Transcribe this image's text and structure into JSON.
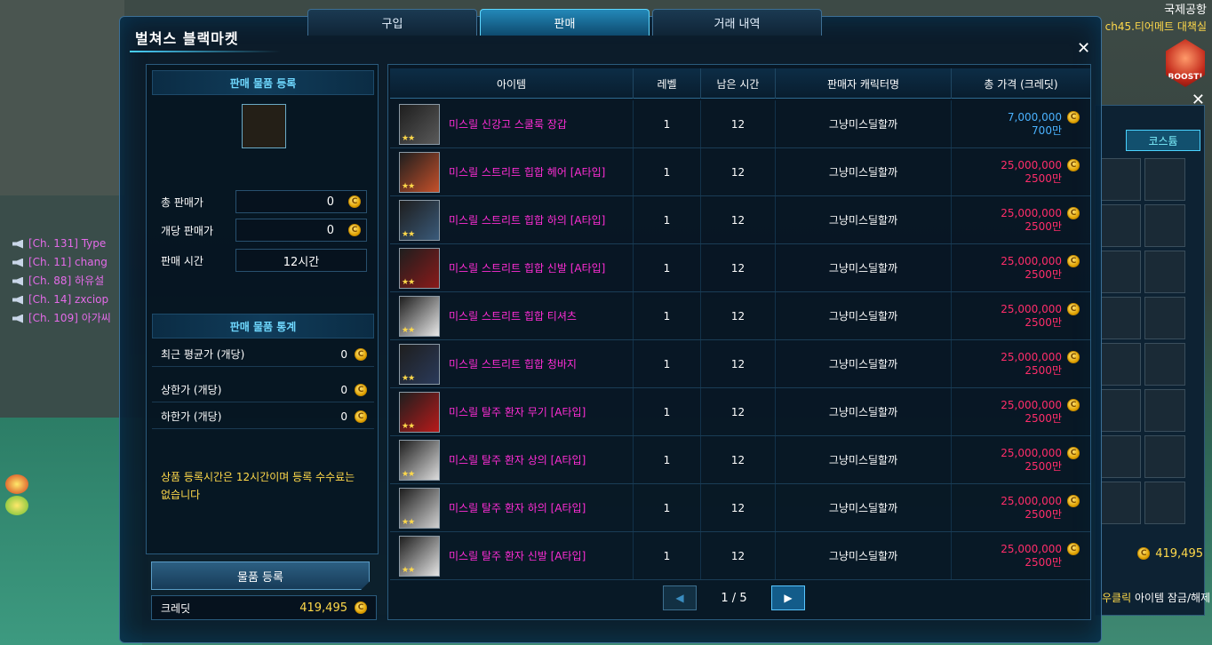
{
  "location": {
    "title": "국제공항",
    "channel": "ch45.티어메트 대책실"
  },
  "boost_label": "BOOST!",
  "chat": [
    {
      "text": "[Ch. 131] Type"
    },
    {
      "text": "[Ch. 11] chang"
    },
    {
      "text": "[Ch. 88] 하유설"
    },
    {
      "text": "[Ch. 14] zxciop"
    },
    {
      "text": "[Ch. 109] 아가씨"
    }
  ],
  "window": {
    "title": "벌쳐스 블랙마켓",
    "tabs": [
      {
        "label": "구입"
      },
      {
        "label": "판매"
      },
      {
        "label": "거래 내역"
      }
    ],
    "active_tab": "판매"
  },
  "register": {
    "header": "판매 물품 등록",
    "total_price_label": "총 판매가",
    "total_price_value": "0",
    "unit_price_label": "개당 판매가",
    "unit_price_value": "0",
    "time_label": "판매 시간",
    "time_value": "12시간"
  },
  "stats": {
    "header": "판매 물품 통계",
    "recent_avg_label": "최근 평균가 (개당)",
    "recent_avg_value": "0",
    "upper_label": "상한가 (개당)",
    "upper_value": "0",
    "lower_label": "하한가 (개당)",
    "lower_value": "0"
  },
  "notice": "상품 등록시간은 12시간이며 등록 수수료는 없습니다",
  "register_button": "물품 등록",
  "credit": {
    "label": "크레딧",
    "amount": "419,495"
  },
  "table": {
    "headers": [
      "아이템",
      "레벨",
      "남은 시간",
      "판매자 캐릭터명",
      "총 가격 (크레딧)"
    ],
    "rows": [
      {
        "name": "미스릴 신강고 스쿨룩 장갑",
        "level": "1",
        "time": "12",
        "seller": "그냥미스딜할까",
        "price": "7,000,000",
        "price_short": "700만",
        "tone": "blue",
        "thumb": "#5a5a5a"
      },
      {
        "name": "미스릴 스트리트 힙합 헤어 [A타입]",
        "level": "1",
        "time": "12",
        "seller": "그냥미스딜할까",
        "price": "25,000,000",
        "price_short": "2500만",
        "tone": "red",
        "thumb": "#c5502a"
      },
      {
        "name": "미스릴 스트리트 힙합 하의 [A타입]",
        "level": "1",
        "time": "12",
        "seller": "그냥미스딜할까",
        "price": "25,000,000",
        "price_short": "2500만",
        "tone": "red",
        "thumb": "#3a5a7a"
      },
      {
        "name": "미스릴 스트리트 힙합 신발 [A타입]",
        "level": "1",
        "time": "12",
        "seller": "그냥미스딜할까",
        "price": "25,000,000",
        "price_short": "2500만",
        "tone": "red",
        "thumb": "#8a1a1a"
      },
      {
        "name": "미스릴 스트리트 힙합 티셔츠",
        "level": "1",
        "time": "12",
        "seller": "그냥미스딜할까",
        "price": "25,000,000",
        "price_short": "2500만",
        "tone": "red",
        "thumb": "#e8e8e8"
      },
      {
        "name": "미스릴 스트리트 힙합 청바지",
        "level": "1",
        "time": "12",
        "seller": "그냥미스딜할까",
        "price": "25,000,000",
        "price_short": "2500만",
        "tone": "red",
        "thumb": "#2a3a5a"
      },
      {
        "name": "미스릴 탈주 환자 무기 [A타입]",
        "level": "1",
        "time": "12",
        "seller": "그냥미스딜할까",
        "price": "25,000,000",
        "price_short": "2500만",
        "tone": "red",
        "thumb": "#b81a1a"
      },
      {
        "name": "미스릴 탈주 환자 상의 [A타입]",
        "level": "1",
        "time": "12",
        "seller": "그냥미스딜할까",
        "price": "25,000,000",
        "price_short": "2500만",
        "tone": "red",
        "thumb": "#dcdcdc"
      },
      {
        "name": "미스릴 탈주 환자 하의 [A타입]",
        "level": "1",
        "time": "12",
        "seller": "그냥미스딜할까",
        "price": "25,000,000",
        "price_short": "2500만",
        "tone": "red",
        "thumb": "#d0d0d0"
      },
      {
        "name": "미스릴 탈주 환자 신발 [A타입]",
        "level": "1",
        "time": "12",
        "seller": "그냥미스딜할까",
        "price": "25,000,000",
        "price_short": "2500만",
        "tone": "red",
        "thumb": "#e4e4e4"
      }
    ]
  },
  "pagination": {
    "text": "1 / 5"
  },
  "inventory": {
    "tab": "코스튬",
    "money": "419,495",
    "hint_key": "우클릭",
    "hint_text": " 아이템 잠금/해제"
  }
}
